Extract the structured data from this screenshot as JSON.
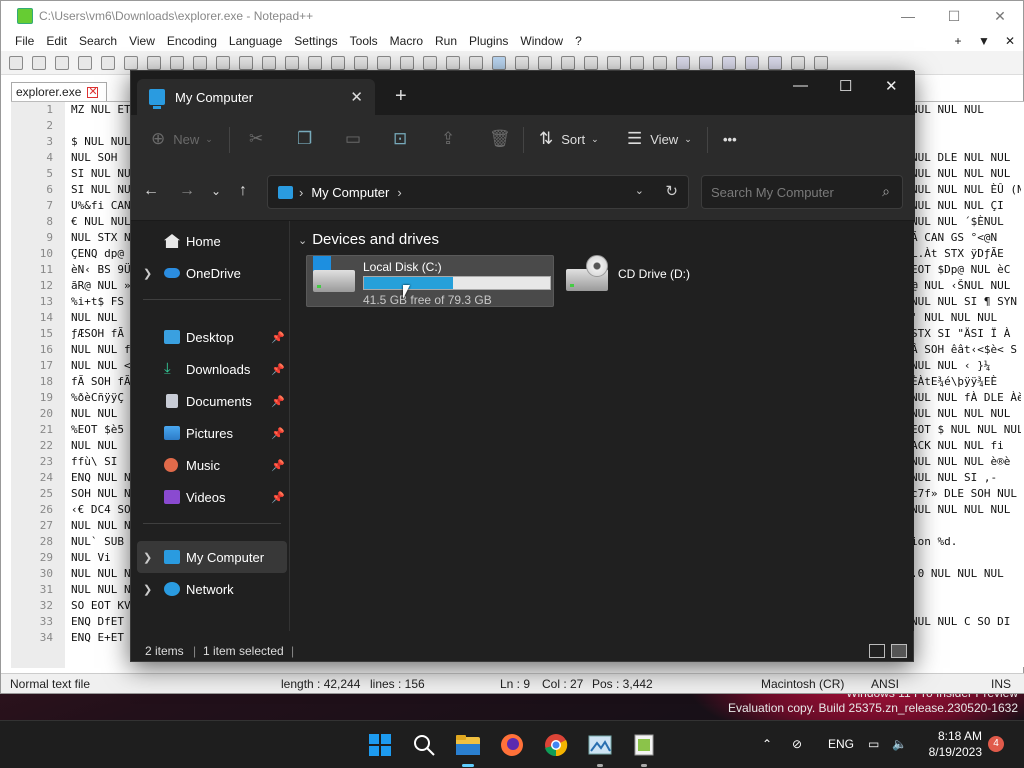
{
  "notepad": {
    "title": "C:\\Users\\vm6\\Downloads\\explorer.exe - Notepad++",
    "menu": [
      "File",
      "Edit",
      "Search",
      "View",
      "Encoding",
      "Language",
      "Settings",
      "Tools",
      "Macro",
      "Run",
      "Plugins",
      "Window",
      "?"
    ],
    "tab": "explorer.exe",
    "line_numbers": [
      "1",
      "2",
      "3",
      "4",
      "5",
      "6",
      "7",
      "8",
      "9",
      "10",
      "11",
      "12",
      "13",
      "14",
      "15",
      "16",
      "17",
      "18",
      "19",
      "20",
      "21",
      "22",
      "23",
      "24",
      "25",
      "26",
      "27",
      "28",
      "29",
      "30",
      "31",
      "32",
      "33",
      "34"
    ],
    "left_code": [
      "MZ NUL ET",
      "",
      "$ NUL NUL",
      "NUL SOH",
      "SI NUL NU",
      "SI NUL NU",
      "U%&fi CAN",
      "€ NUL NUL",
      "NUL STX NU",
      "ÇENQ dp@",
      "èN‹ BS 9Ü",
      "ãR@ NUL »",
      "%i+t$ FS",
      "NUL NUL",
      "ƒÆSOH fÃ",
      "NUL NUL f",
      "NUL NUL <",
      "fÃ SOH fÃ",
      "%ðèCñÿÿÇ",
      "NUL NUL",
      "%EOT $è5",
      "NUL NUL",
      "ffù\\ SI",
      "ENQ NUL N",
      "SOH NUL N",
      "‹€ DC4 SO",
      "NUL NUL N",
      "NUL` SUB",
      "NUL  Vi",
      "NUL NUL N",
      "NUL NUL N",
      "SO EOT KV",
      "ENQ DfET",
      "ENQ E+ET"
    ],
    "right_code": [
      "NUL NUL NUL",
      "",
      "",
      "NUL DLE NUL NUL",
      "NUL NUL NUL NUL",
      "NUL NUL NUL ÈÛ (N",
      "NUL NUL NUL ÇI",
      "NUL NUL ´$ÈNUL",
      "Ã CAN GS °<@N",
      "L.Àt STX ÿDƒÃE",
      "EOT $Dp@ NUL èC",
      "@ NUL ‹ŠNUL NUL",
      "NUL NUL SI ¶ SYN",
      "' NUL NUL NUL",
      "STX SI \"ÄSI Ï À",
      "Â SOH êât‹<$è< S",
      "NUL NUL ‹ }¼",
      "ÈÀtE¾é\\þÿÿ¾EÈ",
      "NUL NUL fÀ DLE Àè",
      "NUL NUL NUL NUL",
      "EOT $ NUL NUL NUL",
      "ACK NUL NUL fi",
      "NUL NUL NUL è®è",
      "NUL NUL SI ,-",
      "c7f» DLE SOH NUL",
      "NUL NUL NUL NUL",
      "",
      "ion %d.",
      "",
      ".0 NUL NUL NUL",
      "",
      "",
      "NUL NUL C SO  DI",
      ""
    ],
    "status": {
      "type": "Normal text file",
      "length": "length : 42,244",
      "lines": "lines : 156",
      "ln": "Ln : 9",
      "col": "Col : 27",
      "pos": "Pos : 3,442",
      "eol": "Macintosh (CR)",
      "enc": "ANSI",
      "mode": "INS"
    }
  },
  "explorer": {
    "tab_title": "My Computer",
    "toolbar": {
      "new": "New",
      "sort": "Sort",
      "view": "View",
      "more": "•••"
    },
    "breadcrumb": "My Computer",
    "search_placeholder": "Search My Computer",
    "nav": [
      {
        "label": "Home",
        "icon": "home-icon"
      },
      {
        "label": "OneDrive",
        "icon": "onedrive-icon"
      },
      {
        "label": "Desktop",
        "icon": "desktop-icon"
      },
      {
        "label": "Downloads",
        "icon": "downloads-icon"
      },
      {
        "label": "Documents",
        "icon": "documents-icon"
      },
      {
        "label": "Pictures",
        "icon": "pictures-icon"
      },
      {
        "label": "Music",
        "icon": "music-icon"
      },
      {
        "label": "Videos",
        "icon": "videos-icon"
      },
      {
        "label": "My Computer",
        "icon": "computer-icon"
      },
      {
        "label": "Network",
        "icon": "network-icon"
      }
    ],
    "group_title": "Devices and drives",
    "drives": [
      {
        "name": "Local Disk (C:)",
        "free_text": "41.5 GB free of 79.3 GB",
        "used_fraction": 0.477
      },
      {
        "name": "CD Drive (D:)"
      }
    ],
    "status": {
      "items": "2 items",
      "selected": "1 item selected"
    }
  },
  "watermark": {
    "line1": "Windows 11 Pro Insider Preview",
    "line2": "Evaluation copy. Build 25375.zn_release.230520-1632"
  },
  "taskbar": {
    "lang": "ENG",
    "time": "8:18 AM",
    "date": "8/19/2023",
    "badge": "4"
  },
  "colors": {
    "accent": "#26a0da",
    "explorer_bg": "#202020",
    "taskbar_bg": "#1e1e1e"
  }
}
